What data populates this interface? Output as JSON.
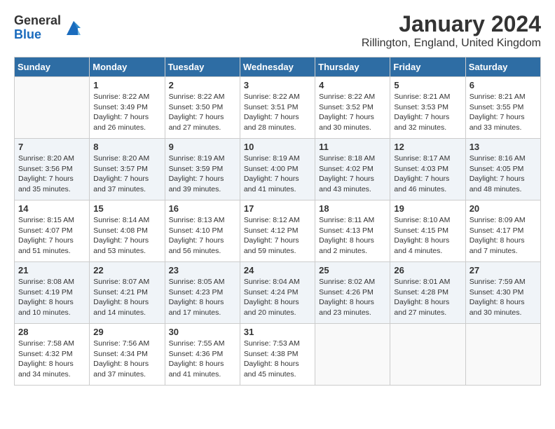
{
  "logo": {
    "general": "General",
    "blue": "Blue"
  },
  "title": "January 2024",
  "subtitle": "Rillington, England, United Kingdom",
  "days_of_week": [
    "Sunday",
    "Monday",
    "Tuesday",
    "Wednesday",
    "Thursday",
    "Friday",
    "Saturday"
  ],
  "weeks": [
    [
      {
        "day": "",
        "info": ""
      },
      {
        "day": "1",
        "info": "Sunrise: 8:22 AM\nSunset: 3:49 PM\nDaylight: 7 hours\nand 26 minutes."
      },
      {
        "day": "2",
        "info": "Sunrise: 8:22 AM\nSunset: 3:50 PM\nDaylight: 7 hours\nand 27 minutes."
      },
      {
        "day": "3",
        "info": "Sunrise: 8:22 AM\nSunset: 3:51 PM\nDaylight: 7 hours\nand 28 minutes."
      },
      {
        "day": "4",
        "info": "Sunrise: 8:22 AM\nSunset: 3:52 PM\nDaylight: 7 hours\nand 30 minutes."
      },
      {
        "day": "5",
        "info": "Sunrise: 8:21 AM\nSunset: 3:53 PM\nDaylight: 7 hours\nand 32 minutes."
      },
      {
        "day": "6",
        "info": "Sunrise: 8:21 AM\nSunset: 3:55 PM\nDaylight: 7 hours\nand 33 minutes."
      }
    ],
    [
      {
        "day": "7",
        "info": "Sunrise: 8:20 AM\nSunset: 3:56 PM\nDaylight: 7 hours\nand 35 minutes."
      },
      {
        "day": "8",
        "info": "Sunrise: 8:20 AM\nSunset: 3:57 PM\nDaylight: 7 hours\nand 37 minutes."
      },
      {
        "day": "9",
        "info": "Sunrise: 8:19 AM\nSunset: 3:59 PM\nDaylight: 7 hours\nand 39 minutes."
      },
      {
        "day": "10",
        "info": "Sunrise: 8:19 AM\nSunset: 4:00 PM\nDaylight: 7 hours\nand 41 minutes."
      },
      {
        "day": "11",
        "info": "Sunrise: 8:18 AM\nSunset: 4:02 PM\nDaylight: 7 hours\nand 43 minutes."
      },
      {
        "day": "12",
        "info": "Sunrise: 8:17 AM\nSunset: 4:03 PM\nDaylight: 7 hours\nand 46 minutes."
      },
      {
        "day": "13",
        "info": "Sunrise: 8:16 AM\nSunset: 4:05 PM\nDaylight: 7 hours\nand 48 minutes."
      }
    ],
    [
      {
        "day": "14",
        "info": "Sunrise: 8:15 AM\nSunset: 4:07 PM\nDaylight: 7 hours\nand 51 minutes."
      },
      {
        "day": "15",
        "info": "Sunrise: 8:14 AM\nSunset: 4:08 PM\nDaylight: 7 hours\nand 53 minutes."
      },
      {
        "day": "16",
        "info": "Sunrise: 8:13 AM\nSunset: 4:10 PM\nDaylight: 7 hours\nand 56 minutes."
      },
      {
        "day": "17",
        "info": "Sunrise: 8:12 AM\nSunset: 4:12 PM\nDaylight: 7 hours\nand 59 minutes."
      },
      {
        "day": "18",
        "info": "Sunrise: 8:11 AM\nSunset: 4:13 PM\nDaylight: 8 hours\nand 2 minutes."
      },
      {
        "day": "19",
        "info": "Sunrise: 8:10 AM\nSunset: 4:15 PM\nDaylight: 8 hours\nand 4 minutes."
      },
      {
        "day": "20",
        "info": "Sunrise: 8:09 AM\nSunset: 4:17 PM\nDaylight: 8 hours\nand 7 minutes."
      }
    ],
    [
      {
        "day": "21",
        "info": "Sunrise: 8:08 AM\nSunset: 4:19 PM\nDaylight: 8 hours\nand 10 minutes."
      },
      {
        "day": "22",
        "info": "Sunrise: 8:07 AM\nSunset: 4:21 PM\nDaylight: 8 hours\nand 14 minutes."
      },
      {
        "day": "23",
        "info": "Sunrise: 8:05 AM\nSunset: 4:23 PM\nDaylight: 8 hours\nand 17 minutes."
      },
      {
        "day": "24",
        "info": "Sunrise: 8:04 AM\nSunset: 4:24 PM\nDaylight: 8 hours\nand 20 minutes."
      },
      {
        "day": "25",
        "info": "Sunrise: 8:02 AM\nSunset: 4:26 PM\nDaylight: 8 hours\nand 23 minutes."
      },
      {
        "day": "26",
        "info": "Sunrise: 8:01 AM\nSunset: 4:28 PM\nDaylight: 8 hours\nand 27 minutes."
      },
      {
        "day": "27",
        "info": "Sunrise: 7:59 AM\nSunset: 4:30 PM\nDaylight: 8 hours\nand 30 minutes."
      }
    ],
    [
      {
        "day": "28",
        "info": "Sunrise: 7:58 AM\nSunset: 4:32 PM\nDaylight: 8 hours\nand 34 minutes."
      },
      {
        "day": "29",
        "info": "Sunrise: 7:56 AM\nSunset: 4:34 PM\nDaylight: 8 hours\nand 37 minutes."
      },
      {
        "day": "30",
        "info": "Sunrise: 7:55 AM\nSunset: 4:36 PM\nDaylight: 8 hours\nand 41 minutes."
      },
      {
        "day": "31",
        "info": "Sunrise: 7:53 AM\nSunset: 4:38 PM\nDaylight: 8 hours\nand 45 minutes."
      },
      {
        "day": "",
        "info": ""
      },
      {
        "day": "",
        "info": ""
      },
      {
        "day": "",
        "info": ""
      }
    ]
  ]
}
